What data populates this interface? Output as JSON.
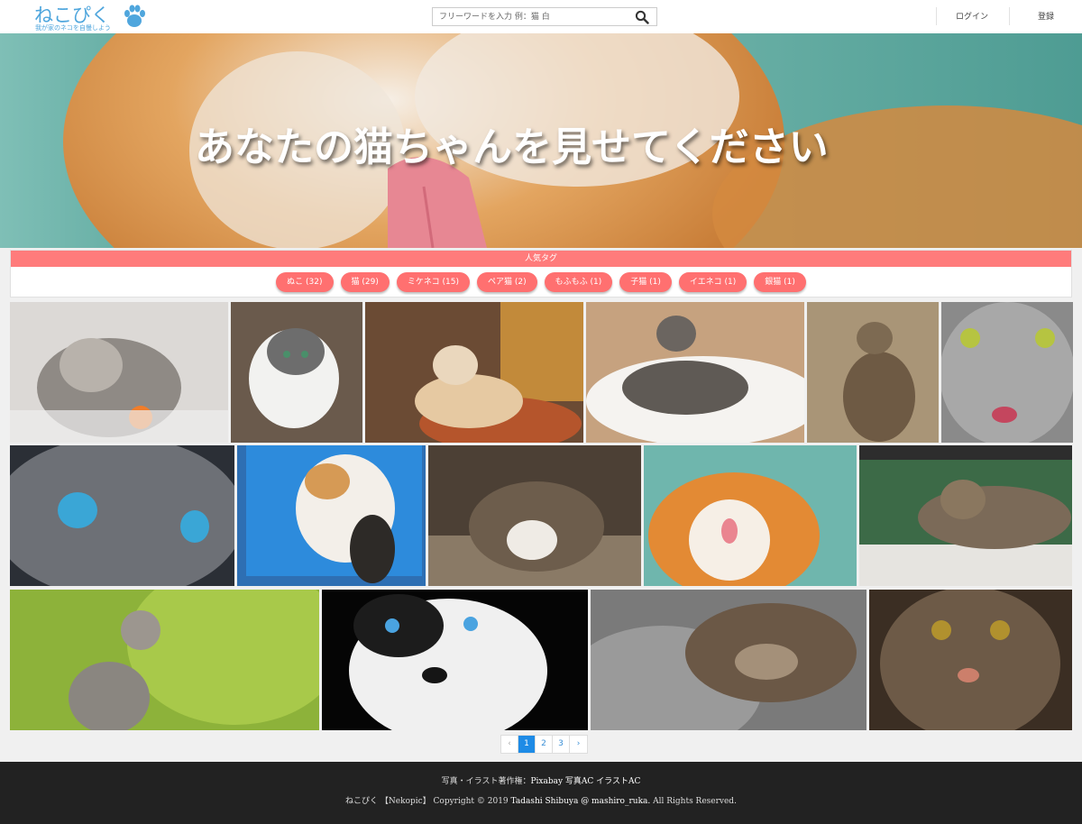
{
  "header": {
    "logo_title": "ねこぴく",
    "logo_subtitle": "我が家のネコを自慢しよう",
    "search_placeholder": "フリーワードを入力 例：猫 白",
    "login": "ログイン",
    "register": "登録"
  },
  "hero": {
    "headline": "あなたの猫ちゃんを見せてください"
  },
  "tags": {
    "heading": "人気タグ",
    "items": [
      "ぬこ (32)",
      "猫 (29)",
      "ミケネコ (15)",
      "ペア猫 (2)",
      "もふもふ (1)",
      "子猫 (1)",
      "イエネコ (1)",
      "銀猫 (1)"
    ]
  },
  "pagination": {
    "prev": "‹",
    "pages": [
      "1",
      "2",
      "3"
    ],
    "current": "1",
    "next": "›"
  },
  "footer": {
    "credit_label": "写真・イラスト著作権：",
    "credit_sources": "Pixabay 写真AC イラストAC",
    "copyright_prefix": "ねこぴく 【Nekopic】 Copyright © 2019",
    "copyright_author": "Tadashi Shibuya @ mashiro_ruka.",
    "copyright_suffix": "All Rights Reserved."
  },
  "colors": {
    "brand_blue": "#4fa6dd",
    "tag_red": "#ff7070",
    "tag_header": "#ff7b7b",
    "pager_active": "#1e8be6",
    "footer_bg": "#222222"
  }
}
